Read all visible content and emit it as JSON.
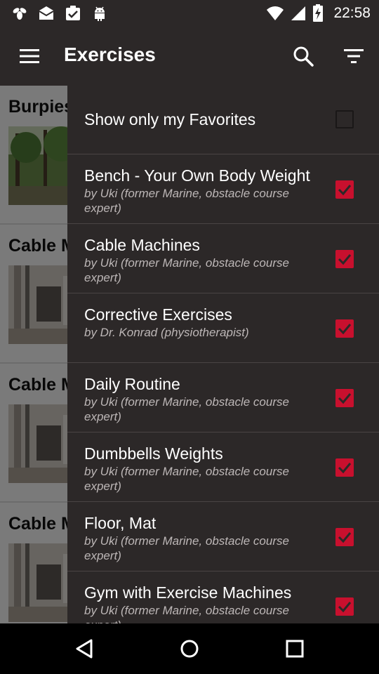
{
  "status": {
    "time": "22:58"
  },
  "appbar": {
    "title": "Exercises"
  },
  "cards": [
    {
      "title": "Burpies"
    },
    {
      "title": "Cable M"
    },
    {
      "title": "Cable M"
    },
    {
      "title": "Cable M"
    }
  ],
  "filter": {
    "favorites_label": "Show only my Favorites",
    "favorites_checked": false,
    "items": [
      {
        "title": "Bench - Your Own Body Weight",
        "author": "by Uki (former Marine, obstacle course expert)",
        "checked": true
      },
      {
        "title": "Cable Machines",
        "author": "by Uki (former Marine, obstacle course expert)",
        "checked": true
      },
      {
        "title": "Corrective Exercises",
        "author": "by Dr. Konrad (physiotherapist)",
        "checked": true
      },
      {
        "title": "Daily Routine",
        "author": "by Uki (former Marine, obstacle course expert)",
        "checked": true
      },
      {
        "title": "Dumbbells Weights",
        "author": "by Uki (former Marine, obstacle course expert)",
        "checked": true
      },
      {
        "title": "Floor, Mat",
        "author": "by Uki (former Marine, obstacle course expert)",
        "checked": true
      },
      {
        "title": "Gym with Exercise Machines",
        "author": "by Uki (former Marine, obstacle course expert)",
        "checked": true
      }
    ]
  },
  "colors": {
    "accent": "#c8102e",
    "toolbar": "#2c2828",
    "panel": "#2c2828"
  },
  "icons": {
    "status_left": [
      "bee-icon",
      "mail-icon",
      "clipboard-check-icon",
      "android-icon"
    ],
    "status_right": [
      "wifi-icon",
      "signal-icon",
      "battery-charging-icon"
    ],
    "appbar": [
      "menu-icon",
      "search-icon",
      "filter-icon"
    ],
    "nav": [
      "back-icon",
      "home-icon",
      "recents-icon"
    ]
  }
}
